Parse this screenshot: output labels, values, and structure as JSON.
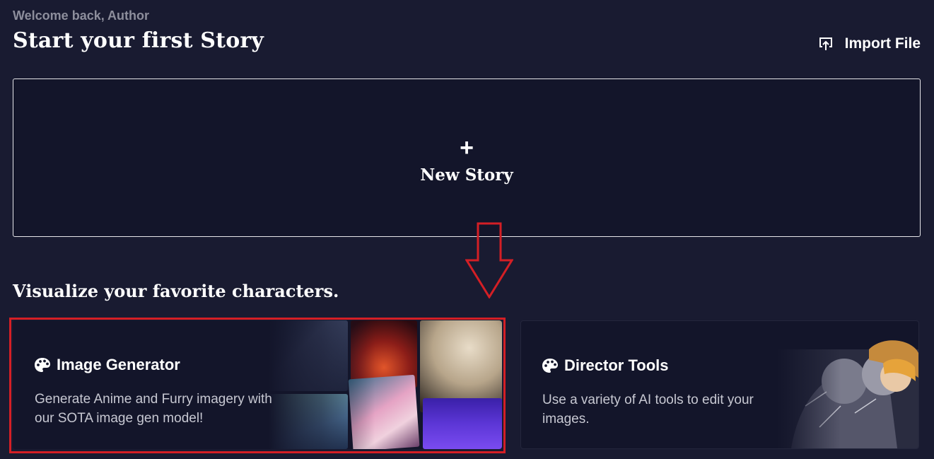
{
  "header": {
    "welcome_text": "Welcome back, Author",
    "headline": "Start your first Story",
    "import_label": "Import File",
    "import_icon": "upload-icon"
  },
  "new_story": {
    "plus_symbol": "+",
    "label": "New Story"
  },
  "section": {
    "title": "Visualize your favorite characters."
  },
  "cards": [
    {
      "icon": "palette-icon",
      "title": "Image Generator",
      "description": "Generate Anime and Furry imagery with our SOTA image gen model!"
    },
    {
      "icon": "palette-icon",
      "title": "Director Tools",
      "description": "Use a variety of AI tools to edit your images."
    }
  ],
  "annotation": {
    "highlight_color": "#d41f25",
    "arrow_color": "#d41f25"
  },
  "colors": {
    "background": "#191b31",
    "card_background": "#13152a",
    "muted_text": "#8d8e9c"
  }
}
